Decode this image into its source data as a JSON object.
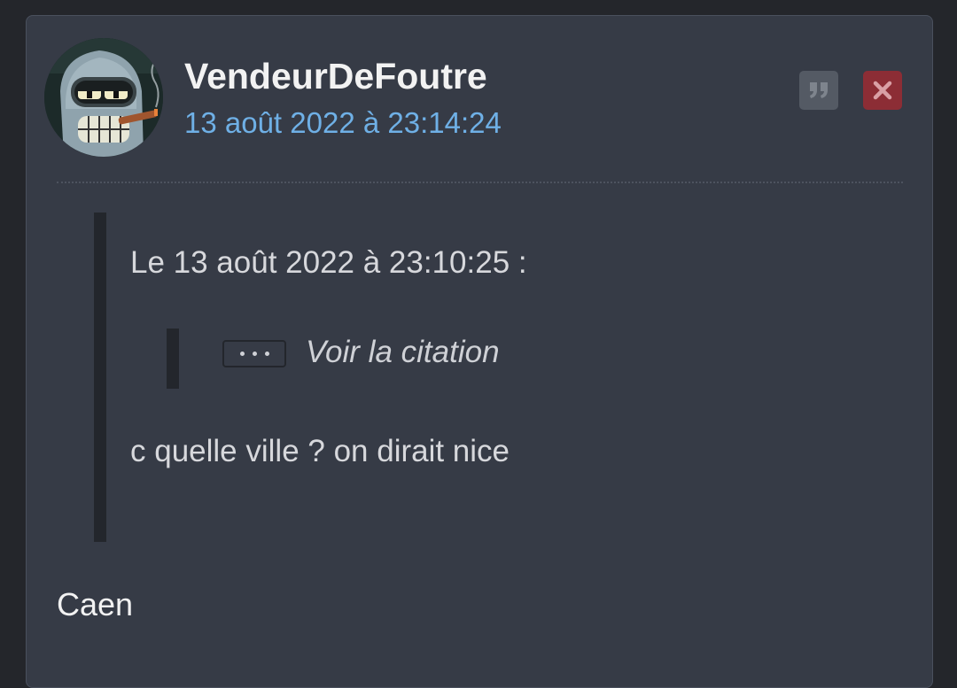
{
  "post": {
    "author": "VendeurDeFoutre",
    "timestamp": "13 août 2022 à 23:14:24",
    "avatar_icon": "bender-avatar",
    "actions": {
      "quote_icon": "quote-icon",
      "delete_icon": "close-icon"
    },
    "quote": {
      "header": "Le 13 août 2022 à 23:10:25 :",
      "nested_quote_label": "Voir la citation",
      "text": "c quelle ville ? on dirait nice"
    },
    "reply": "Caen"
  },
  "colors": {
    "background": "#24262b",
    "card": "#363b46",
    "timestamp": "#6fb0e6",
    "delete_button": "#8c2d35",
    "quote_button": "#545a64"
  }
}
